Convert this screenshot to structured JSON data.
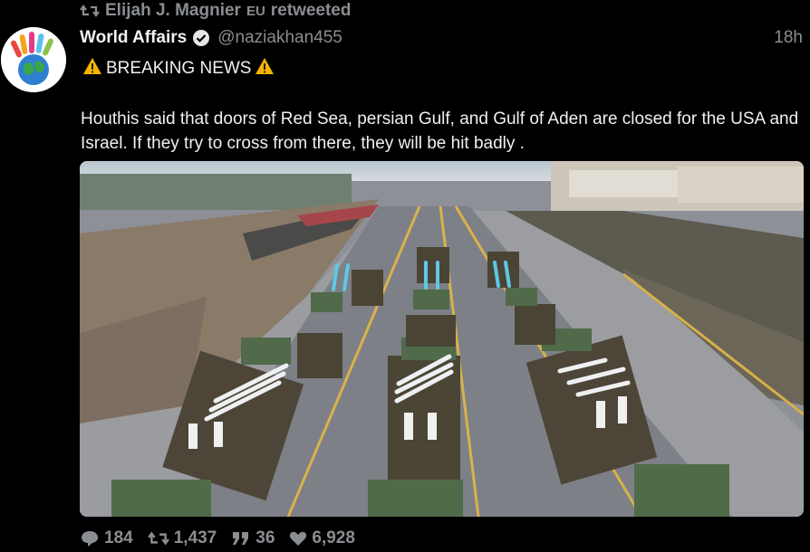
{
  "retweet": {
    "retweeter": "Elijah J. Magnier",
    "flag": "EU",
    "suffix": "retweeted"
  },
  "tweet": {
    "display_name": "World Affairs",
    "handle": "@naziakhan455",
    "time": "18h",
    "headline": "BREAKING NEWS",
    "body": "Houthis said that doors of Red Sea,  persian Gulf,  and Gulf of Aden are closed for the USA and Israel. If they try to cross from there,  they will be hit badly ."
  },
  "icons": {
    "retweet": "retweet-icon",
    "verified": "verified-badge-icon",
    "warning": "warning-icon",
    "reply": "reply-icon",
    "like": "heart-icon",
    "quote": "quote-icon"
  },
  "actions": {
    "replies": "184",
    "retweets": "1,437",
    "quotes": "36",
    "likes": "6,928"
  },
  "colors": {
    "background": "#000000",
    "text": "#f0f0f0",
    "muted": "#8a8d91",
    "warning": "#f5b400"
  }
}
